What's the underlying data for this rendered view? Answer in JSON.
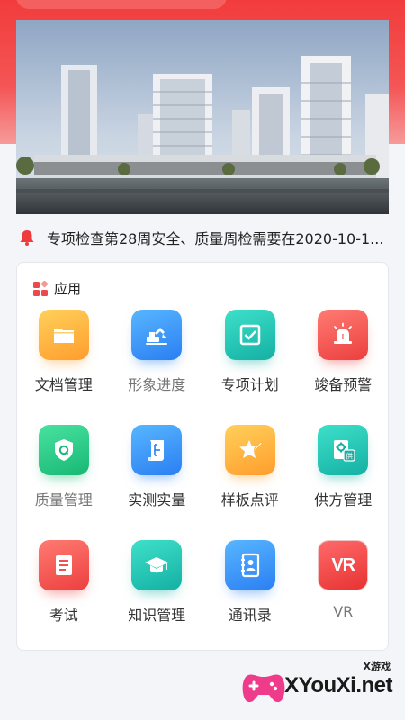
{
  "banner": {
    "alt": "building"
  },
  "notice": {
    "text": "专项检查第28周安全、质量周检需要在2020-10-1..."
  },
  "apps": {
    "title": "应用",
    "items": [
      {
        "label": "文档管理",
        "icon": "folder-icon"
      },
      {
        "label": "形象进度",
        "icon": "excavator-icon"
      },
      {
        "label": "专项计划",
        "icon": "checkbox-icon"
      },
      {
        "label": "竣备预警",
        "icon": "alarm-light-icon"
      },
      {
        "label": "质量管理",
        "icon": "shield-q-icon"
      },
      {
        "label": "实测实量",
        "icon": "measure-scroll-icon"
      },
      {
        "label": "样板点评",
        "icon": "star-pen-icon"
      },
      {
        "label": "供方管理",
        "icon": "supplier-gear-icon"
      },
      {
        "label": "考试",
        "icon": "exam-book-icon"
      },
      {
        "label": "知识管理",
        "icon": "graduation-cap-icon"
      },
      {
        "label": "通讯录",
        "icon": "contacts-book-icon"
      },
      {
        "label": "VR",
        "icon": "vr-icon"
      }
    ]
  },
  "watermark": {
    "small": "X游戏",
    "big": "XYouXi.net"
  },
  "colors": {
    "primary": "#f23c3c",
    "background": "#f4f5f9"
  }
}
